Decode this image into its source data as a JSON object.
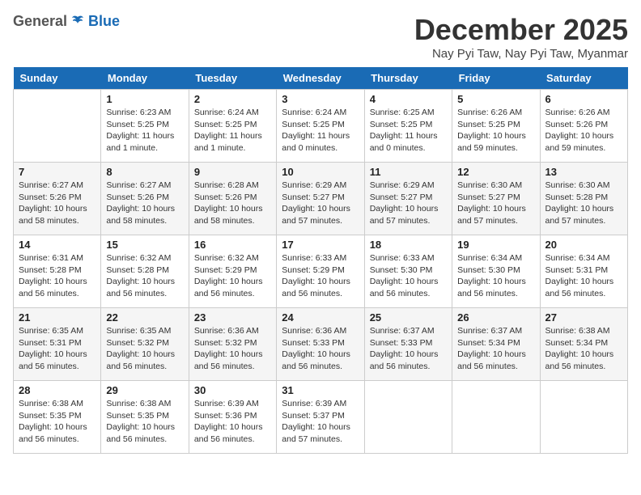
{
  "logo": {
    "general": "General",
    "blue": "Blue"
  },
  "title": "December 2025",
  "location": "Nay Pyi Taw, Nay Pyi Taw, Myanmar",
  "days_header": [
    "Sunday",
    "Monday",
    "Tuesday",
    "Wednesday",
    "Thursday",
    "Friday",
    "Saturday"
  ],
  "weeks": [
    [
      {
        "num": "",
        "info": ""
      },
      {
        "num": "1",
        "info": "Sunrise: 6:23 AM\nSunset: 5:25 PM\nDaylight: 11 hours\nand 1 minute."
      },
      {
        "num": "2",
        "info": "Sunrise: 6:24 AM\nSunset: 5:25 PM\nDaylight: 11 hours\nand 1 minute."
      },
      {
        "num": "3",
        "info": "Sunrise: 6:24 AM\nSunset: 5:25 PM\nDaylight: 11 hours\nand 0 minutes."
      },
      {
        "num": "4",
        "info": "Sunrise: 6:25 AM\nSunset: 5:25 PM\nDaylight: 11 hours\nand 0 minutes."
      },
      {
        "num": "5",
        "info": "Sunrise: 6:26 AM\nSunset: 5:25 PM\nDaylight: 10 hours\nand 59 minutes."
      },
      {
        "num": "6",
        "info": "Sunrise: 6:26 AM\nSunset: 5:26 PM\nDaylight: 10 hours\nand 59 minutes."
      }
    ],
    [
      {
        "num": "7",
        "info": "Sunrise: 6:27 AM\nSunset: 5:26 PM\nDaylight: 10 hours\nand 58 minutes."
      },
      {
        "num": "8",
        "info": "Sunrise: 6:27 AM\nSunset: 5:26 PM\nDaylight: 10 hours\nand 58 minutes."
      },
      {
        "num": "9",
        "info": "Sunrise: 6:28 AM\nSunset: 5:26 PM\nDaylight: 10 hours\nand 58 minutes."
      },
      {
        "num": "10",
        "info": "Sunrise: 6:29 AM\nSunset: 5:27 PM\nDaylight: 10 hours\nand 57 minutes."
      },
      {
        "num": "11",
        "info": "Sunrise: 6:29 AM\nSunset: 5:27 PM\nDaylight: 10 hours\nand 57 minutes."
      },
      {
        "num": "12",
        "info": "Sunrise: 6:30 AM\nSunset: 5:27 PM\nDaylight: 10 hours\nand 57 minutes."
      },
      {
        "num": "13",
        "info": "Sunrise: 6:30 AM\nSunset: 5:28 PM\nDaylight: 10 hours\nand 57 minutes."
      }
    ],
    [
      {
        "num": "14",
        "info": "Sunrise: 6:31 AM\nSunset: 5:28 PM\nDaylight: 10 hours\nand 56 minutes."
      },
      {
        "num": "15",
        "info": "Sunrise: 6:32 AM\nSunset: 5:28 PM\nDaylight: 10 hours\nand 56 minutes."
      },
      {
        "num": "16",
        "info": "Sunrise: 6:32 AM\nSunset: 5:29 PM\nDaylight: 10 hours\nand 56 minutes."
      },
      {
        "num": "17",
        "info": "Sunrise: 6:33 AM\nSunset: 5:29 PM\nDaylight: 10 hours\nand 56 minutes."
      },
      {
        "num": "18",
        "info": "Sunrise: 6:33 AM\nSunset: 5:30 PM\nDaylight: 10 hours\nand 56 minutes."
      },
      {
        "num": "19",
        "info": "Sunrise: 6:34 AM\nSunset: 5:30 PM\nDaylight: 10 hours\nand 56 minutes."
      },
      {
        "num": "20",
        "info": "Sunrise: 6:34 AM\nSunset: 5:31 PM\nDaylight: 10 hours\nand 56 minutes."
      }
    ],
    [
      {
        "num": "21",
        "info": "Sunrise: 6:35 AM\nSunset: 5:31 PM\nDaylight: 10 hours\nand 56 minutes."
      },
      {
        "num": "22",
        "info": "Sunrise: 6:35 AM\nSunset: 5:32 PM\nDaylight: 10 hours\nand 56 minutes."
      },
      {
        "num": "23",
        "info": "Sunrise: 6:36 AM\nSunset: 5:32 PM\nDaylight: 10 hours\nand 56 minutes."
      },
      {
        "num": "24",
        "info": "Sunrise: 6:36 AM\nSunset: 5:33 PM\nDaylight: 10 hours\nand 56 minutes."
      },
      {
        "num": "25",
        "info": "Sunrise: 6:37 AM\nSunset: 5:33 PM\nDaylight: 10 hours\nand 56 minutes."
      },
      {
        "num": "26",
        "info": "Sunrise: 6:37 AM\nSunset: 5:34 PM\nDaylight: 10 hours\nand 56 minutes."
      },
      {
        "num": "27",
        "info": "Sunrise: 6:38 AM\nSunset: 5:34 PM\nDaylight: 10 hours\nand 56 minutes."
      }
    ],
    [
      {
        "num": "28",
        "info": "Sunrise: 6:38 AM\nSunset: 5:35 PM\nDaylight: 10 hours\nand 56 minutes."
      },
      {
        "num": "29",
        "info": "Sunrise: 6:38 AM\nSunset: 5:35 PM\nDaylight: 10 hours\nand 56 minutes."
      },
      {
        "num": "30",
        "info": "Sunrise: 6:39 AM\nSunset: 5:36 PM\nDaylight: 10 hours\nand 56 minutes."
      },
      {
        "num": "31",
        "info": "Sunrise: 6:39 AM\nSunset: 5:37 PM\nDaylight: 10 hours\nand 57 minutes."
      },
      {
        "num": "",
        "info": ""
      },
      {
        "num": "",
        "info": ""
      },
      {
        "num": "",
        "info": ""
      }
    ]
  ]
}
